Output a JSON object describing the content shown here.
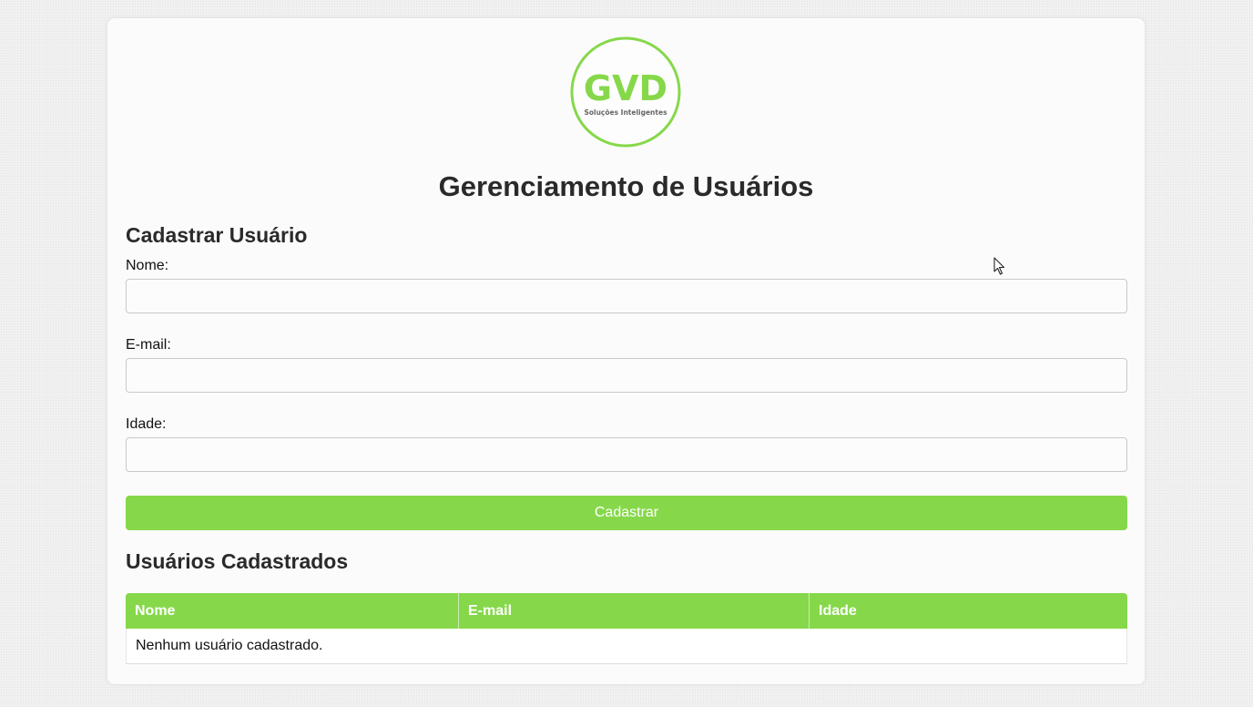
{
  "logo": {
    "brand": "GVD",
    "tagline": "Soluções Inteligentes",
    "color": "#86d84a"
  },
  "page": {
    "title": "Gerenciamento de Usuários"
  },
  "form": {
    "title": "Cadastrar Usuário",
    "fields": [
      {
        "label": "Nome:",
        "value": "",
        "placeholder": ""
      },
      {
        "label": "E-mail:",
        "value": "",
        "placeholder": ""
      },
      {
        "label": "Idade:",
        "value": "",
        "placeholder": ""
      }
    ],
    "submit_label": "Cadastrar"
  },
  "users": {
    "title": "Usuários Cadastrados",
    "columns": [
      "Nome",
      "E-mail",
      "Idade"
    ],
    "empty_message": "Nenhum usuário cadastrado."
  },
  "colors": {
    "accent": "#86d84a",
    "card_bg": "#fbfbfb",
    "text": "#2a2a2a"
  }
}
